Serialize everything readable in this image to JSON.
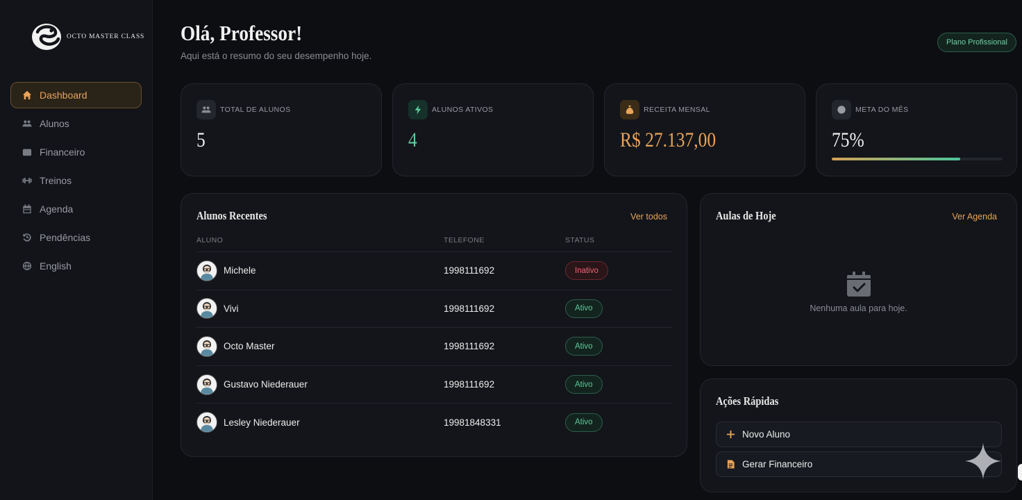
{
  "brand": {
    "name": "OCTO MASTER CLASS"
  },
  "sidebar": {
    "items": [
      {
        "label": "Dashboard",
        "icon": "home-icon",
        "active": true
      },
      {
        "label": "Alunos",
        "icon": "users-icon"
      },
      {
        "label": "Financeiro",
        "icon": "wallet-icon"
      },
      {
        "label": "Treinos",
        "icon": "dumbbell-icon"
      },
      {
        "label": "Agenda",
        "icon": "calendar-icon"
      },
      {
        "label": "Pendências",
        "icon": "history-icon"
      },
      {
        "label": "English",
        "icon": "globe-icon"
      }
    ]
  },
  "header": {
    "greeting": "Olá, Professor!",
    "subtitle": "Aqui está o resumo do seu desempenho hoje.",
    "plan": "Plano Profissional"
  },
  "stats": {
    "total": {
      "label": "TOTAL DE ALUNOS",
      "value": "5",
      "icon": "users-icon"
    },
    "active": {
      "label": "ALUNOS ATIVOS",
      "value": "4",
      "icon": "bolt-icon"
    },
    "revenue": {
      "label": "RECEITA MENSAL",
      "value": "R$ 27.137,00",
      "icon": "money-bag-icon"
    },
    "goal": {
      "label": "META DO MÊS",
      "value": "75%",
      "progress": 0.75,
      "icon": "circle-icon"
    }
  },
  "recent": {
    "title": "Alunos Recentes",
    "link": "Ver todos",
    "columns": {
      "student": "ALUNO",
      "phone": "TELEFONE",
      "status": "STATUS"
    },
    "rows": [
      {
        "name": "Michele",
        "phone": "1998111692",
        "status": "Inativo",
        "active": false
      },
      {
        "name": "Vivi",
        "phone": "1998111692",
        "status": "Ativo",
        "active": true
      },
      {
        "name": "Octo Master",
        "phone": "1998111692",
        "status": "Ativo",
        "active": true
      },
      {
        "name": "Gustavo Niederauer",
        "phone": "1998111692",
        "status": "Ativo",
        "active": true
      },
      {
        "name": "Lesley Niederauer",
        "phone": "19981848331",
        "status": "Ativo",
        "active": true
      }
    ]
  },
  "today": {
    "title": "Aulas de Hoje",
    "link": "Ver Agenda",
    "empty": "Nenhuma aula para hoje."
  },
  "quick": {
    "title": "Ações Rápidas",
    "new_student": "Novo Aluno",
    "generate_finance": "Gerar Financeiro"
  },
  "colors": {
    "accent": "#e8a45a",
    "success": "#5fc89d",
    "danger": "#e36b74",
    "background": "#0d0e12"
  }
}
